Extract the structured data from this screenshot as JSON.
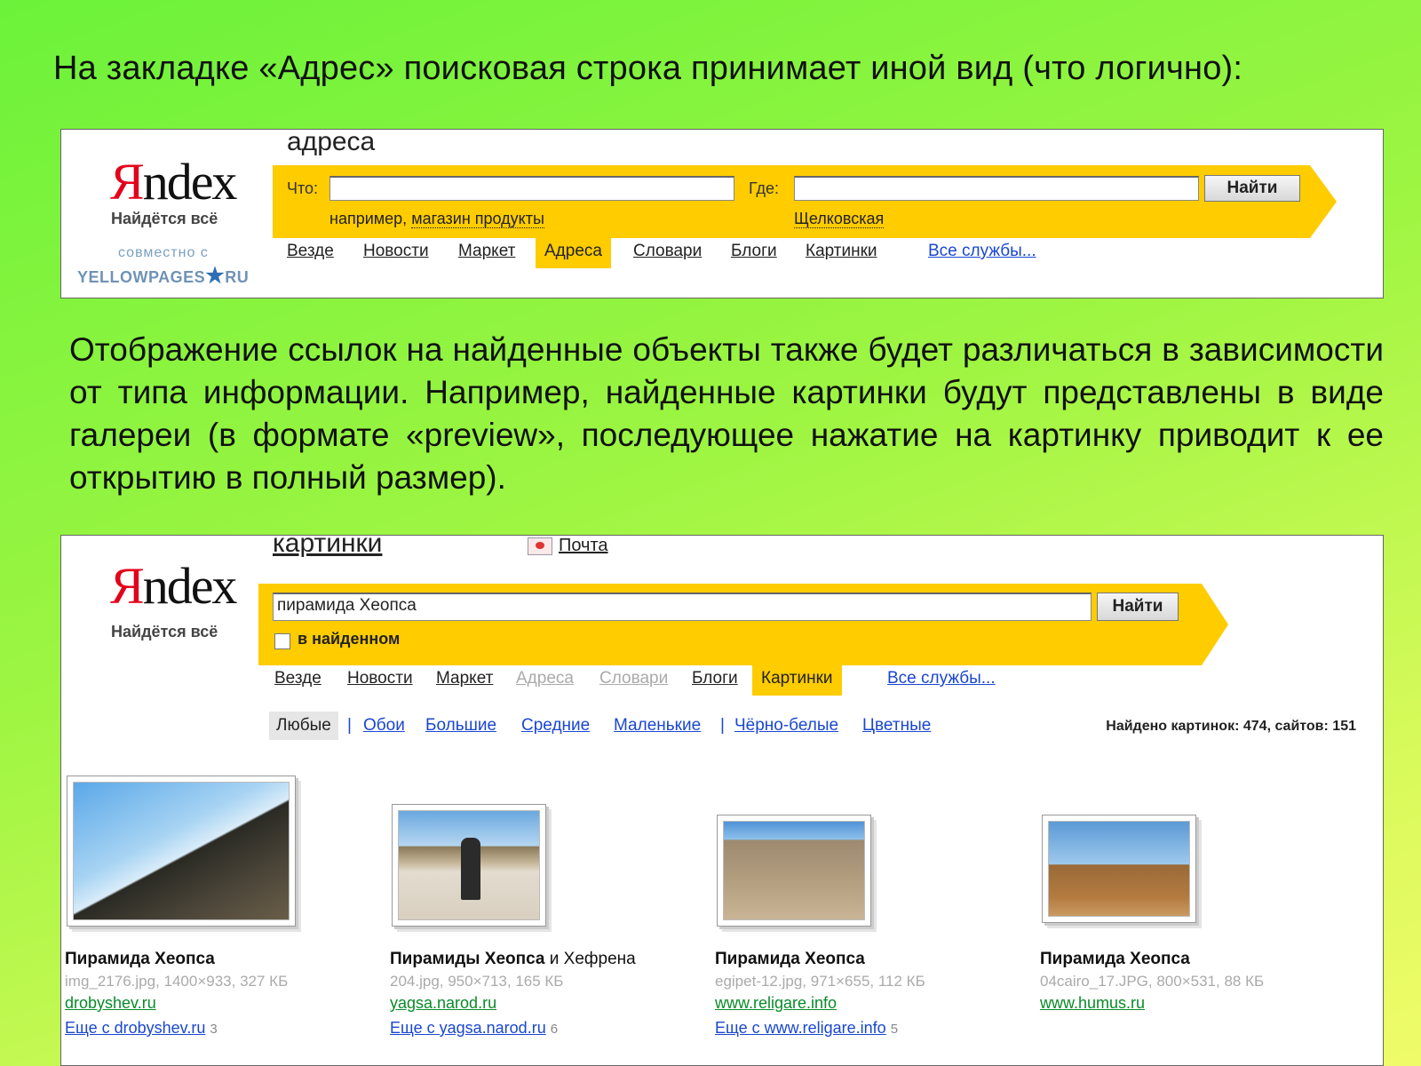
{
  "heading": "На закладке «Адрес» поисковая строка принимает иной вид (что логично):",
  "paragraph": "Отображение ссылок на найденные объекты также будет различаться в зависимости от типа информации. Например, найденные картинки будут представлены в виде галереи (в формате «preview», последующее нажатие на картинку приводит к ее открытию в полный размер).",
  "colors": {
    "accent": "#ffcc00",
    "logo_red": "#e3001b",
    "link": "#1a47d0",
    "site": "#0a8a2a"
  },
  "panel1": {
    "logo_first": "Я",
    "logo_rest": "ndex",
    "slogan": "Найдётся всё",
    "partner_label": "совместно с",
    "partner_logo_left": "YELLOWPAGES",
    "partner_logo_right": "RU",
    "service_title": "адреса",
    "what_label": "Что:",
    "what_value": "",
    "where_label": "Где:",
    "where_value": "",
    "find_button": "Найти",
    "hint_prefix": "например,",
    "hint_example": "магазин продукты",
    "where_hint": "Щелковская",
    "tabs": [
      "Везде",
      "Новости",
      "Маркет",
      "Адреса",
      "Словари",
      "Блоги",
      "Картинки"
    ],
    "all_services": "Все службы..."
  },
  "panel2": {
    "logo_first": "Я",
    "logo_rest": "ndex",
    "slogan": "Найдётся всё",
    "service_title": "картинки",
    "mail_label": "Почта",
    "query": "пирамида Хеопса",
    "find_button": "Найти",
    "in_found_label": "в найденном",
    "in_found_checked": false,
    "tabs": [
      "Везде",
      "Новости",
      "Маркет",
      "Адреса",
      "Словари",
      "Блоги",
      "Картинки"
    ],
    "all_services": "Все службы...",
    "filters": [
      "Любые",
      "Обои",
      "Большие",
      "Средние",
      "Маленькие",
      "Чёрно-белые",
      "Цветные"
    ],
    "found_label": "Найдено картинок:",
    "found_images": "474",
    "sites_label": ", сайтов:",
    "found_sites": "151",
    "results": [
      {
        "title_bold": "Пирамида Хеопса",
        "title_rest": "",
        "meta": "img_2176.jpg, 1400×933, 327 КБ",
        "site": "drobyshev.ru",
        "more": "Еще с drobyshev.ru",
        "more_count": "3"
      },
      {
        "title_bold": "Пирамиды Хеопса",
        "title_rest": " и Хефрена",
        "meta": "204.jpg, 950×713, 165 КБ",
        "site": "yagsa.narod.ru",
        "more": "Еще с yagsa.narod.ru",
        "more_count": "6"
      },
      {
        "title_bold": "Пирамида Хеопса",
        "title_rest": "",
        "meta": "egipet-12.jpg, 971×655, 112 КБ",
        "site": "www.religare.info",
        "more": "Еще с www.religare.info",
        "more_count": "5"
      },
      {
        "title_bold": "Пирамида Хеопса",
        "title_rest": "",
        "meta": "04cairo_17.JPG, 800×531, 88 КБ",
        "site": "www.humus.ru",
        "more": "",
        "more_count": ""
      }
    ]
  }
}
